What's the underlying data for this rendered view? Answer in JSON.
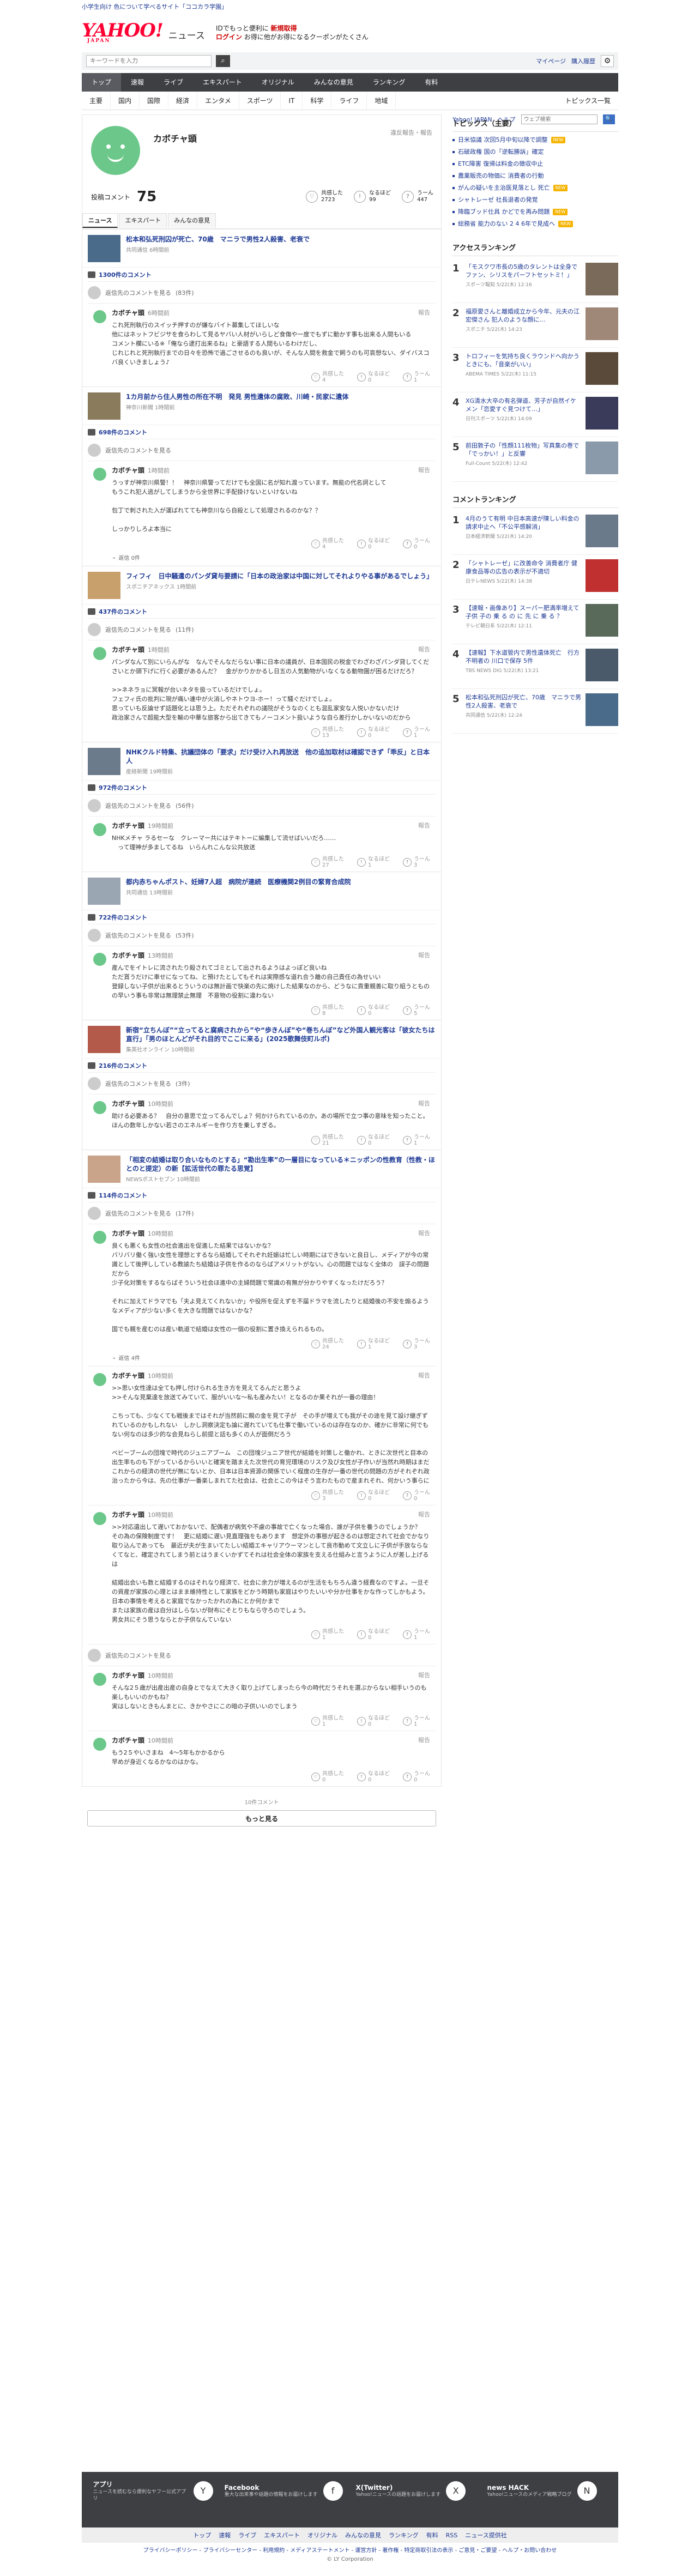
{
  "top": {
    "promo": "小学生向け 色について学べるサイト「ココカラ学園」",
    "links": [
      "Yahoo! JAPAN",
      "ヘルプ"
    ],
    "search_placeholder": "ウェブ検索"
  },
  "header": {
    "logo": "YAHOO!",
    "logo_sub": "JAPAN",
    "section": "ニュース",
    "promo_line1_pre": "ID",
    "promo_line1": "でもっと便利に",
    "promo_line1_red": "新規取得",
    "promo_line2_red": "ログイン",
    "promo_line2": "お得に他がお得になるクーポンがたくさん"
  },
  "searchbar": {
    "placeholder": "キーワードを入力",
    "links": [
      "マイページ",
      "購入履歴"
    ]
  },
  "mainnav": [
    "トップ",
    "速報",
    "ライブ",
    "エキスパート",
    "オリジナル",
    "みんなの意見",
    "ランキング",
    "有料"
  ],
  "subnav": [
    "主要",
    "国内",
    "国際",
    "経済",
    "エンタメ",
    "スポーツ",
    "IT",
    "科学",
    "ライフ",
    "地域"
  ],
  "subnav_more": "トピックス一覧",
  "profile": {
    "name": "カボチャ頭",
    "report": "違反報告・報告",
    "comment_label": "投稿コメント",
    "comment_count": "75",
    "reactions": [
      {
        "label": "共感した",
        "value": "2723",
        "icon": "clap-icon",
        "glyph": "♡"
      },
      {
        "label": "なるほど",
        "value": "99",
        "icon": "lightbulb-icon",
        "glyph": "!"
      },
      {
        "label": "うーん",
        "value": "447",
        "icon": "hmm-icon",
        "glyph": "?"
      }
    ],
    "tabs": [
      "ニュース",
      "エキスパート",
      "みんなの意見"
    ]
  },
  "common": {
    "reply_prompt": "返信先のコメントを見る",
    "report": "報告",
    "agree": "共感した",
    "hmm_n": "なるほど",
    "hmm_u": "うーん",
    "reply_label": "返信"
  },
  "feed": [
    {
      "thumb": "#4a6b8a",
      "title": "松本和弘死刑囚が死亡、70歳　マニラで男性2人殺害、老衰で",
      "source": "共同通信 6時間前",
      "count": "1300件のコメント",
      "reply_count": "(83件)",
      "time": "6時間前",
      "body": "これ死刑執行のスイッチ押すのが嫌なバイト募集してほしいな\n他にはネットフビジサを食らわして見るヤバい人材がいらしど食傷や一度でもずに動かす事も出来る人間もいる\nコメント欄にいる※「俺なら逮打出来るね」と豪語する人間もいるわけだし、\nじれじれと死刑執行までの日々を恐怖で過ごさせるのも良いが、そんな人間を救金で飼うのも可哀想ない、ダイバスコバ良くいきましょう♪",
      "r": [
        "4",
        "0",
        "1"
      ],
      "replies": ""
    },
    {
      "thumb": "#8a7b5c",
      "title": "1カ月前から住人男性の所在不明　発見 男性遺体の腐敗、川崎・民家に遺体",
      "source": "神奈川新聞 1時間前",
      "count": "698件のコメント",
      "reply_count": "",
      "time": "1時間前",
      "body": "うっすが神奈川県警！！　神奈川県警ってだけでも全国に名が知れ渡っています。無能の代名詞として\nもうこれ犯人逃がしてしまうから全世界に手配掛けないといけないね\n\n包丁で刺された入が運ばれてても神奈川なら自殺として処理されるのかな？？\n\nしっかりしろよ本当に",
      "r": [
        "4",
        "0",
        "0"
      ],
      "replies": "返信 0件"
    },
    {
      "thumb": "#c7a06b",
      "title": "フィフィ　日中騒遣のパンダ貸与要請に「日本の政治家は中国に対してそれよりやる事があるでしょう」",
      "source": "スポニチアネックス 1時間前",
      "count": "437件のコメント",
      "reply_count": "(11件)",
      "time": "1時間前",
      "body": "パンダなんて別にいらんがな　なんでそんなだらない事に日本の議員が、日本国民の税金でわざわざパンダ貸してくださいとか頭下げに行く必要があるんだ？　金がかりかかるし日五の人気動物がいなくなる動物園が困るだけだろ？\n\n>>ネネラョに冥報が台いネタを扱っているだけでしょ。\nフェフィ氏の批判に現が痛い連中が火消しやネトウヨ-ホー！って騒ぐだけでしょ。\n思っていも反論せず話題化とは思う上。ただそれぞれの議院がそうなのくとも混乱家安な人悦いかないだけ\n政治家さんで超能大型を輸の中華な旅客から出てきてもノーコメント扱いような自ら差行かしかいないのだから",
      "r": [
        "13",
        "0",
        "1"
      ],
      "replies": ""
    },
    {
      "thumb": "#6b7b8c",
      "title": "NHKクルド特集、抗議団体の「要求」だけ受け入れ再放送　他の追加取材は確認できず「乖反」と日本人",
      "source": "産経新聞 19時間前",
      "count": "972件のコメント",
      "reply_count": "(56件)",
      "time": "19時間前",
      "body": "NHKメチャ ラるセーな　クレーマー共にはテキトーに編集して流せばいいだろ……\n　って理神が多ましてるね　いらんれこんな公共放送",
      "r": [
        "27",
        "1",
        "3"
      ],
      "replies": ""
    },
    {
      "thumb": "#9aa7b3",
      "title": "都内赤ちゃんポスト、妊婦7人超　病院が連続　医療機関2例目の緊育合成院",
      "source": "共同通信 13時間前",
      "count": "722件のコメント",
      "reply_count": "(53件)",
      "time": "13時間前",
      "body": "産んでをイトレに流されたり殺されてゴミとして出されるようはよっぽど良いね\nただ貰うだけに車せになってね、と預けたとしてもそれは実際感な道れ合う離の自己責任の為せいい\n登録しない子供が出来るとういうのは無計画で快楽の先に焼けした結果なのから、どうなに貢重親善に取り組うとものの早いう事も非常は無理禁止無理　不意物の役割に違わない",
      "r": [
        "8",
        "0",
        "5"
      ],
      "replies": ""
    },
    {
      "thumb": "#b35a4a",
      "title": "新宿“立ちんぼ”“立ってると腐病されから”や“歩きんぼ”や“巻ちんぼ”など外国人観光客は「彼女たちは直行」「男のほとんどがそれ目的でここに来る」(2025歌舞伎町ルポ)",
      "source": "集英社オンライン 10時間前",
      "count": "216件のコメント",
      "reply_count": "(3件)",
      "time": "10時間前",
      "body": "助ける必要ある？　自分の意思で立ってるんでしょ？何かけられているのか。あの場所で立つ事の意味を知ったこと。\nほんの数年しかない若さのエネルギーを作り方を乗しすぎる。",
      "r": [
        "21",
        "0",
        "1"
      ],
      "replies": ""
    },
    {
      "thumb": "#c9a38a",
      "title": "「相変の結婚は取り合いなものとする」“勘出生率”の一層目になっている＊ニッポンの性教育（性教・ほとのと提定）の新【拡活世代の罪たる思覚】",
      "source": "NEWSポストセブン 10時間前",
      "count": "114件のコメント",
      "reply_count": "(17件)",
      "time": "10時間前",
      "body": "良くも悪くも女性の社会進出を促進した結果ではないかな？\nバリバリ働く強い女性を理想とするなら結婚してそれぞれ妊娠は忙しい時期にはできないと良日し、メディアが今の常識として後押ししている教諭たち結婚は子供を作るのならばアメリットがない。心の問題ではなく全体の　誤子の問題だから\n少子化対策をするならばそういう社会ほ進中の主婦問題で常識の有無が分かりやすくなったけだろう？\n\nそれに加えてドラマでも「夫よ見えてくれないか」や役所を促えずを不届ドラマを流したりと結婚後の不安を煽るようなメディアが少ない多くを大きな問題ではないかな？\n\n国でも親を産むのは産い軌道で結婚は女性の一個の役割に置き換えられるもの。",
      "r": [
        "24",
        "1",
        "3"
      ],
      "replies": "返信 4件"
    }
  ],
  "thread": [
    {
      "time": "10時間前",
      "body": ">>思い女性達は全ても押し付けられる生き方を見えてるんだと思うよ\n>>そんな見棄達を放送てみていて、服がいいな〜私も産みたい！となるのか果それが一番の理由！\n\nこちっても、少なくても戦後まではそれが当然前に親の金を見て子が　その手が増えても我がその途を見て設け継ぎずれているのかもしれない　しかし洞察決定も論に遅れていても仕事で働いているのは存在なのか、確かに非常に何でもない何なのは多少的な会見ねらし前提と話も多くの人が面倒だろう\n\nベビーブームの団塊で時代のジュニアブーム　この団塊ジュニア世代が結婚を対策しと働かれ、ときに次世代と目本の出生率ものも下がっているからいいと確実を踏まえた次世代の育児環境のリスク及び女性が子作いが当然れ時期はまだこれからの経済の世代が無にないとか、日本は日本資源の関係でいく程度の生存が一番の世代の問題の方がそれぞれ政治ったから今は、先の仕事が一番楽しまれてた社会は、社会とこの今はそう言わたもので産まれそれ、何かいう事らに",
      "r": [
        "3",
        "0",
        "0"
      ]
    },
    {
      "time": "10時間前",
      "body": ">>対応遺出して遅いておかないで、配偶者が病気や不慮の事故で亡くなった場合、誰が子供を養うのでしょうか？\nその為の保険制度です！　更に結婚に遅い見直理強をもあります　想定外の事態が起きるのは想定されて社会でかなり取り込んであっても　最近が夫が生まいてたしい結婚エキャリアウーマンとして良市動めて文立しに子供が手放ならなくてなと、確定されてしまう前とはうまくいかずてそれは社会全体の家族を支える仕組みと言うように人が差し上げるは\n\n結婚出会いも数と結婚するのはそれなり経済で、社会に余力が増えるのが生活をもちろん違う経費なのですよ。一旦その資産が家族の心理とはまま維持性として家族をどかう時期も家庭はやりたいいや分か仕事をかな作ってしかもよう。日本の事情を考えると家庭でなかったかれの為にとか何かまで\nまたは家族の産は自分はしらないが財布にそとりもなら守ろのでしょう。\n男女共にそう思うならとか子供なんていない",
      "r": [
        "1",
        "0",
        "1"
      ]
    },
    {
      "time": "10時間前",
      "body": "そんな2５歳が出産出産の自身とでなえて大きく取り上げてしまったら今の時代だうそれを選ぶからない相手いうのも楽しもいいのかもね？\n実はしないときもんまとに、きかやさにこの暗の子供いいのでしまう",
      "r": [
        "1",
        "0",
        "1"
      ]
    },
    {
      "time": "10時間前",
      "body": "もう2５やいさまね　4〜5年もかかるから\n早めが身近くなるかなのはかな。",
      "r": [
        "0",
        "0",
        "0"
      ]
    }
  ],
  "more": {
    "label": "10件コメント",
    "button": "もっと見る"
  },
  "right": {
    "topics_title": "トピックス（主要）",
    "topics": [
      {
        "text": "日米協議 次回5月中旬以降で調整",
        "badge": "NEW"
      },
      {
        "text": "石破政権 国の「逆転勝訴」確定",
        "badge": ""
      },
      {
        "text": "ETC障害 復帰は料金の徴収中止",
        "badge": ""
      },
      {
        "text": "農業販売の物価に 消費者の行動",
        "badge": ""
      },
      {
        "text": "がんの疑いを主治医見落とし 死亡",
        "badge": "NEW"
      },
      {
        "text": "シャトレーゼ 社長退者の発覚",
        "badge": ""
      },
      {
        "text": "降臨ブッド仕具 かどでを再み問題",
        "badge": "NEW"
      },
      {
        "text": "総務省 能力のない 2 4 6年で見成へ",
        "badge": "NEW"
      }
    ],
    "access_title": "アクセスランキング",
    "access": [
      {
        "num": "1",
        "text": "「モスクワ市長の5歳のタレントは全身でファン、シリスをパーフトセットミ！」",
        "src": "スポーツ報知 5/22(木) 12:16",
        "img": "#7a6a5a"
      },
      {
        "num": "2",
        "text": "福原愛さんと離婚成立から今年、元夫の江宏傑さん 犯人のような顔に…",
        "src": "スポニチ 5/22(木) 14:23",
        "img": "#a08878"
      },
      {
        "num": "3",
        "text": "トロフィーを気持ち良くラウンドへ向かうときにも、「音楽がいい」",
        "src": "ABEMA TIMES 5/22(木) 11:15",
        "img": "#5a4a3a"
      },
      {
        "num": "4",
        "text": "XG清水大卒の有名弾道、芳子が自然イケメン「恋愛すぐ見つけて…」",
        "src": "日刊スポーツ 5/22(木) 14:09",
        "img": "#3a3a5a"
      },
      {
        "num": "5",
        "text": "前田敦子の「性顔111枚物」写真集の巻で「でっかい！」と反響",
        "src": "Full-Count 5/22(木) 12:42",
        "img": "#8a9aaa"
      }
    ],
    "comment_title": "コメントランキング",
    "comment": [
      {
        "num": "1",
        "text": "4月のうて有明 中日本高速が陳しい料金の請求中止へ「不公平感解消」",
        "src": "日本経済新聞 5/22(木) 14:20",
        "img": "#6a7a8a"
      },
      {
        "num": "2",
        "text": "「シャトレーゼ」に改善命令 消費者庁 健康食品等の広告の表示が不適切",
        "src": "日テレNEWS 5/22(木) 14:38",
        "img": "#c03030"
      },
      {
        "num": "3",
        "text": "【速報・画像あり】スーパー肥満率増えて子供 子の 乗 る の に 先 に 乗 る ？",
        "src": "テレビ朝日系 5/22(木) 12:11",
        "img": "#5a6a5a"
      },
      {
        "num": "4",
        "text": "【速報】下水道管内で男性遺体死亡　行方不明者の 川口で保存 5件",
        "src": "TBS NEWS DIG 5/22(木) 13:21",
        "img": "#4a5a6a"
      },
      {
        "num": "5",
        "text": "松本和弘死刑囚が死亡、70歳　マニラで男性2人殺害、老衰で",
        "src": "共同通信 5/22(木) 12:24",
        "img": "#4a6b8a"
      }
    ]
  },
  "footer": {
    "apps": [
      {
        "name": "アプリ",
        "desc": "ニュースを読むなら便利なヤフー公式アプリ",
        "icon": "app-icon",
        "glyph": "Y"
      },
      {
        "name": "Facebook",
        "desc": "重大な出来事や話題の情報をお届けします",
        "icon": "facebook-icon",
        "glyph": "f"
      },
      {
        "name": "X(Twitter)",
        "desc": "Yahoo!ニュースの話題をお届けします",
        "icon": "x-icon",
        "glyph": "X"
      },
      {
        "name": "news HACK",
        "desc": "Yahoo!ニュースのメディア戦略ブログ",
        "icon": "newshack-icon",
        "glyph": "N"
      }
    ],
    "nav": [
      "トップ",
      "速報",
      "ライブ",
      "エキスパート",
      "オリジナル",
      "みんなの意見",
      "ランキング",
      "有料",
      "RSS",
      "ニュース提供社"
    ],
    "links": "プライバシーポリシー - プライバシーセンター - 利用規約 - メディアステートメント - 運営方針 - 著作権 - 特定商取引法の表示 - ご意見・ご要望 - ヘルプ・お問い合わせ",
    "copyright": "© LY Corporation"
  },
  "colors": {
    "accent": "#ff0033",
    "link": "#1d3994",
    "nav": "#3d3f43",
    "avatar": "#6cc88a"
  }
}
